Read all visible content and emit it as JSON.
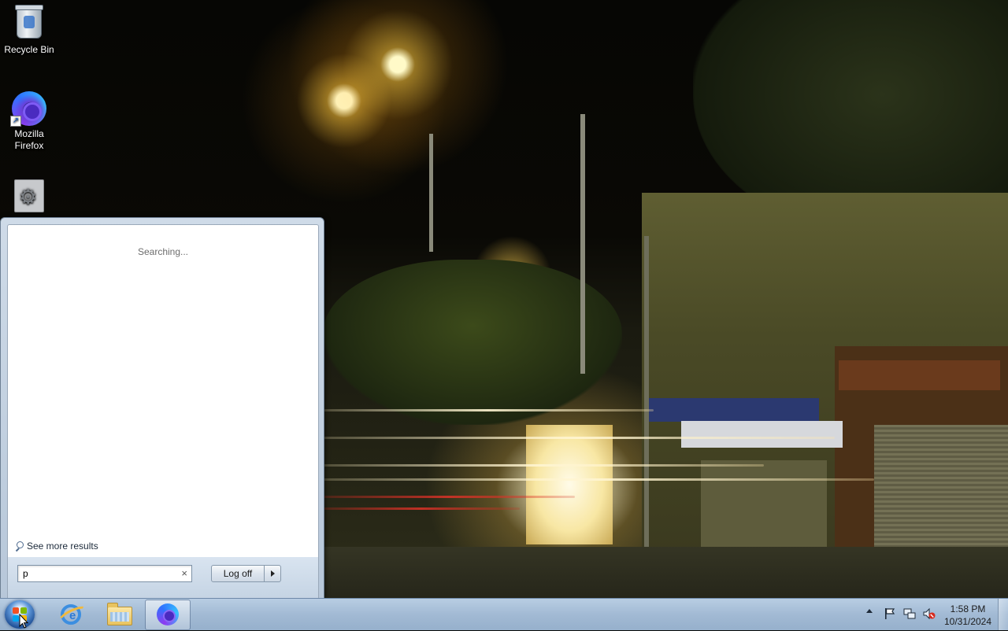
{
  "desktop": {
    "icons": [
      {
        "label": "Recycle Bin",
        "icon": "recycle-bin-icon"
      },
      {
        "label": "Mozilla\nFirefox",
        "icon": "firefox-icon"
      },
      {
        "label": "",
        "icon": "settings-file-icon"
      }
    ]
  },
  "start_menu": {
    "status_text": "Searching...",
    "see_more_label": "See more results",
    "search": {
      "value": "p",
      "clear_symbol": "×"
    },
    "logoff_label": "Log off"
  },
  "taskbar": {
    "pinned": [
      {
        "icon": "internet-explorer-icon"
      },
      {
        "icon": "windows-explorer-icon"
      },
      {
        "icon": "firefox-icon",
        "active": true
      }
    ],
    "tray": {
      "icons": [
        "show-hidden-icons-arrow",
        "action-center-flag-icon",
        "network-icon",
        "volume-muted-icon"
      ]
    },
    "clock": {
      "time": "1:58 PM",
      "date": "10/31/2024"
    }
  },
  "colors": {
    "taskbar": "#a2bad4",
    "start_menu_frame": "#c5d4e4",
    "start_pane": "#ffffff"
  }
}
